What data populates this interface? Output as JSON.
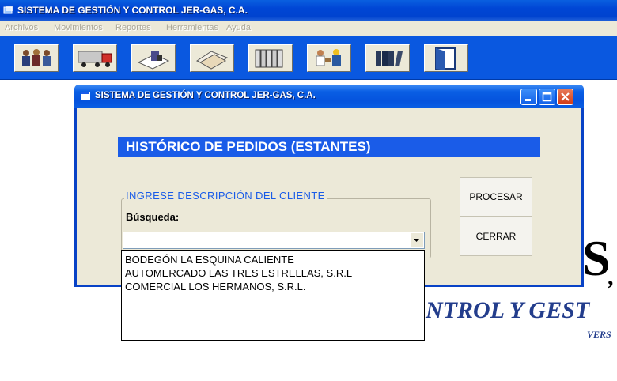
{
  "app": {
    "title": "SISTEMA DE GESTIÓN Y CONTROL JER-GAS, C.A."
  },
  "menu": {
    "items": [
      "Archivos",
      "Movimientos",
      "Reportes",
      "Herramientas",
      "Ayuda"
    ]
  },
  "toolbar": {
    "icons": [
      "clients-icon",
      "truck-icon",
      "documents-icon",
      "papers-icon",
      "binders-icon",
      "workers-icon",
      "books-icon",
      "exit-door-icon"
    ]
  },
  "background": {
    "logo_big": "S",
    "logo_comma": ",",
    "subtitle": "NTROL Y GEST",
    "version": "VERS"
  },
  "dialog": {
    "title": "SISTEMA DE GESTIÓN Y CONTROL JER-GAS, C.A.",
    "header": "HISTÓRICO DE PEDIDOS (ESTANTES)",
    "group_legend": "INGRESE  DESCRIPCIÓN  DEL CLIENTE",
    "search_label": "Búsqueda:",
    "search_value": "",
    "process_label": "PROCESAR",
    "close_label": "CERRAR"
  },
  "dropdown": {
    "options": [
      "BODEGÓN LA ESQUINA CALIENTE",
      "AUTOMERCADO LAS TRES ESTRELLAS, S.R.L",
      "COMERCIAL LOS HERMANOS, S.R.L."
    ]
  },
  "colors": {
    "titlebar": "#0046d5",
    "toolbar": "#0a58e0",
    "header_bar": "#1a5ce8",
    "subtitle_text": "#233d8c"
  }
}
